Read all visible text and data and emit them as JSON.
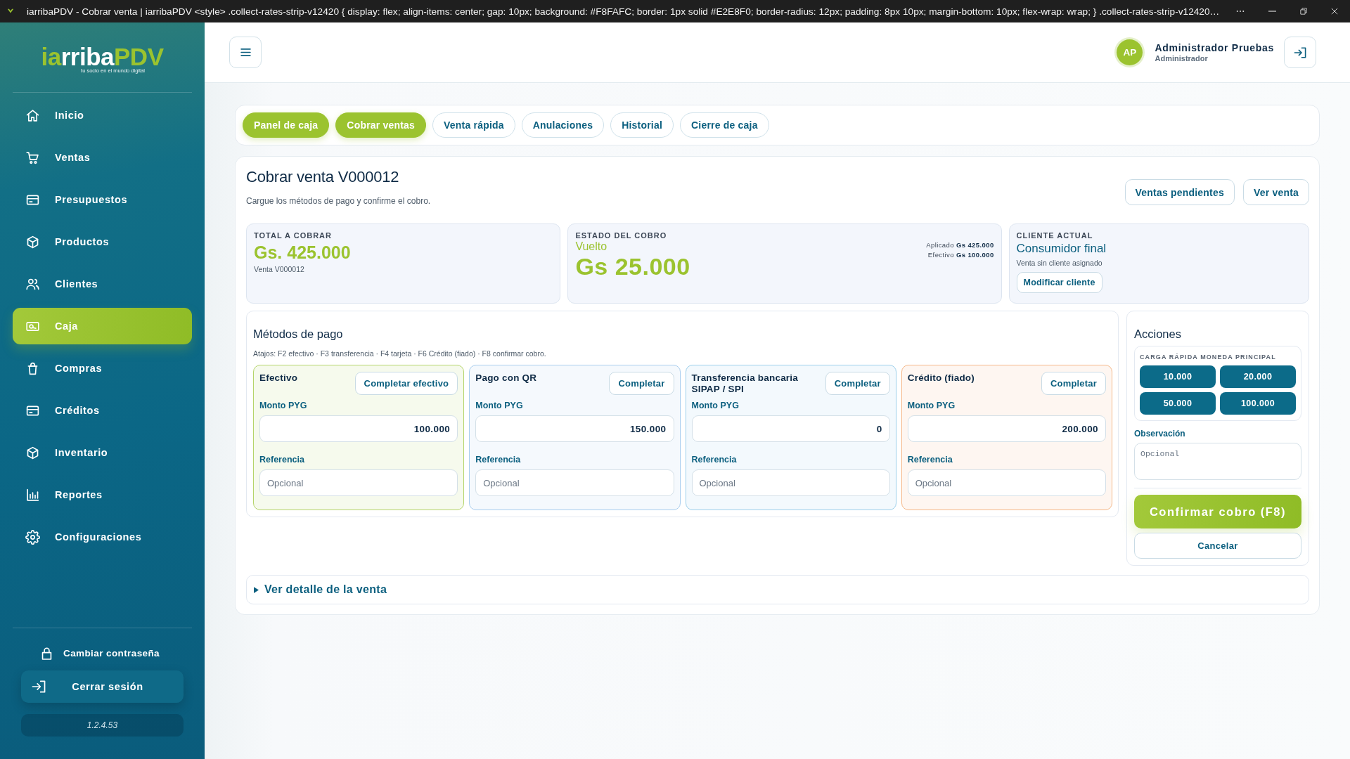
{
  "window": {
    "title": "iarribaPDV - Cobrar venta | iarribaPDV <style> .collect-rates-strip-v12420 { display: flex; align-items: center; gap: 10px; background: #F8FAFC; border: 1px solid #E2E8F0; border-radius: 12px; padding: 8px 10px; margin-bottom: 10px; flex-wrap: wrap; } .collect-rates-strip-v12420…"
  },
  "sidebar": {
    "logo": [
      {
        "text": "ia",
        "color": "#9bc32f"
      },
      {
        "text": "rriba",
        "color": "#ffffff"
      },
      {
        "text": "PDV",
        "color": "#9bc32f"
      }
    ],
    "tagline": "tu socio en el mundo digital",
    "items": [
      {
        "label": "Inicio",
        "selected": false
      },
      {
        "label": "Ventas",
        "selected": false
      },
      {
        "label": "Presupuestos",
        "selected": false
      },
      {
        "label": "Productos",
        "selected": false
      },
      {
        "label": "Clientes",
        "selected": false
      },
      {
        "label": "Caja",
        "selected": true
      },
      {
        "label": "Compras",
        "selected": false
      },
      {
        "label": "Créditos",
        "selected": false
      },
      {
        "label": "Inventario",
        "selected": false
      },
      {
        "label": "Reportes",
        "selected": false
      },
      {
        "label": "Configuraciones",
        "selected": false
      }
    ],
    "change_password": "Cambiar contraseña",
    "logout": "Cerrar sesión",
    "version": "1.2.4.53"
  },
  "header": {
    "avatar_initials": "AP",
    "user_name": "Administrador Pruebas",
    "user_role": "Administrador"
  },
  "tabs": [
    {
      "label": "Panel de caja",
      "selected": true
    },
    {
      "label": "Cobrar ventas",
      "selected": true
    },
    {
      "label": "Venta rápida",
      "selected": false
    },
    {
      "label": "Anulaciones",
      "selected": false
    },
    {
      "label": "Historial",
      "selected": false
    },
    {
      "label": "Cierre de caja",
      "selected": false
    }
  ],
  "page": {
    "title": "Cobrar venta V000012",
    "subtitle": "Cargue los métodos de pago y confirme el cobro.",
    "buttons": [
      "Ventas pendientes",
      "Ver venta"
    ]
  },
  "summary": {
    "total": {
      "label": "TOTAL A COBRAR",
      "amount": "Gs. 425.000",
      "note": "Venta V000012"
    },
    "status": {
      "label": "ESTADO DEL COBRO",
      "result_label": "Vuelto",
      "result_amount": "Gs 25.000",
      "details": [
        "Aplicado **Gs 425.000**",
        "Efectivo **Gs 100.000**"
      ]
    },
    "client": {
      "label": "CLIENTE ACTUAL",
      "name": "Consumidor final",
      "note": "Venta sin cliente asignado",
      "button": "Modificar cliente"
    }
  },
  "payment_methods": {
    "title": "Métodos de pago",
    "shortcuts": "Atajos: F2 efectivo · F3 transferencia · F4 tarjeta · F6 Crédito (fiado) · F8 confirmar cobro.",
    "methods": [
      {
        "name": "Efectivo",
        "button": "Completar efectivo",
        "amount_label": "Monto PYG",
        "amount": "100.000",
        "reference_label": "Referencia",
        "reference_placeholder": "Opcional",
        "color": "#b5d46a"
      },
      {
        "name": "Pago con QR",
        "button": "Completar",
        "amount_label": "Monto PYG",
        "amount": "150.000",
        "reference_label": "Referencia",
        "reference_placeholder": "Opcional",
        "color": "#a8cdee"
      },
      {
        "name": "Transferencia bancaria SIPAP / SPI",
        "button": "Completar",
        "amount_label": "Monto PYG",
        "amount": "0",
        "reference_label": "Referencia",
        "reference_placeholder": "Opcional",
        "color": "#9ccfeb"
      },
      {
        "name": "Crédito (fiado)",
        "button": "Completar",
        "amount_label": "Monto PYG",
        "amount": "200.000",
        "reference_label": "Referencia",
        "reference_placeholder": "Opcional",
        "color": "#f5b889"
      }
    ]
  },
  "actions": {
    "title": "Acciones",
    "quick_load_label": "CARGA RÁPIDA MONEDA PRINCIPAL",
    "quick_amounts": [
      "10.000",
      "20.000",
      "50.000",
      "100.000"
    ],
    "observation_label": "Observación",
    "observation_placeholder": "Opcional",
    "confirm": "Confirmar cobro (F8)",
    "cancel": "Cancelar"
  },
  "detail": {
    "label": "Ver detalle de la venta",
    "expanded": false
  }
}
